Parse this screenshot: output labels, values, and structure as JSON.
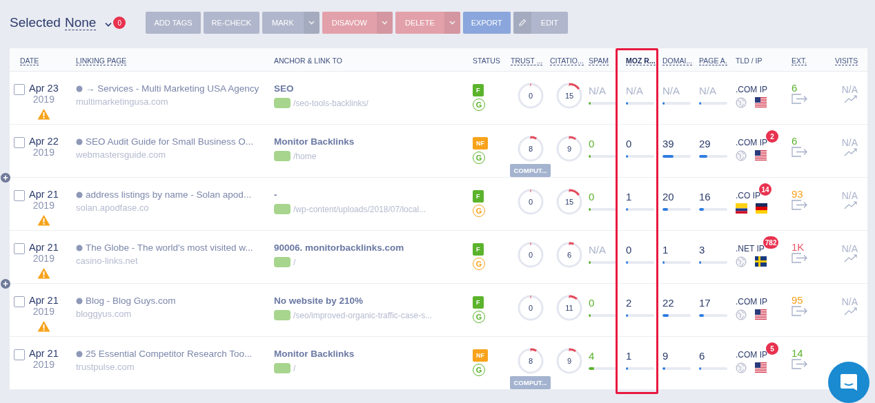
{
  "toolbar": {
    "label": "Selected",
    "selection": "None",
    "count": "0",
    "buttons": [
      {
        "label": "ADD TAGS",
        "kind": "plain",
        "color": "#b0b6cb"
      },
      {
        "label": "RE-CHECK",
        "kind": "plain",
        "color": "#b0b6cb"
      },
      {
        "label": "MARK",
        "kind": "split",
        "color": "#b0b6cb"
      },
      {
        "label": "DISAVOW",
        "kind": "split",
        "color": "#e2a0aa"
      },
      {
        "label": "DELETE",
        "kind": "split",
        "color": "#e2a0aa"
      },
      {
        "label": "EXPORT",
        "kind": "plain",
        "color": "#8aa6dc"
      },
      {
        "label": "EDIT",
        "kind": "pencil",
        "color": "#b0b6cb"
      }
    ]
  },
  "table": {
    "columns": [
      {
        "label": "DATE",
        "sortable": true,
        "highlighted": false
      },
      {
        "label": "LINKING PAGE",
        "sortable": true,
        "highlighted": false
      },
      {
        "label": "ANCHOR & LINK TO",
        "sortable": false,
        "highlighted": false
      },
      {
        "label": "STATUS",
        "sortable": false,
        "highlighted": false
      },
      {
        "label": "TRUST ...",
        "sortable": true,
        "highlighted": false
      },
      {
        "label": "CITATIO...",
        "sortable": true,
        "highlighted": false
      },
      {
        "label": "SPAM",
        "sortable": true,
        "highlighted": false
      },
      {
        "label": "MOZ R...",
        "sortable": true,
        "highlighted": true
      },
      {
        "label": "DOMAI...",
        "sortable": true,
        "highlighted": false
      },
      {
        "label": "PAGE A.",
        "sortable": true,
        "highlighted": false
      },
      {
        "label": "TLD / IP",
        "sortable": false,
        "highlighted": false
      },
      {
        "label": "EXT.",
        "sortable": true,
        "highlighted": false
      },
      {
        "label": "VISITS",
        "sortable": true,
        "highlighted": false
      }
    ],
    "rows": [
      {
        "checked": false,
        "add_above": false,
        "date": "Apr 23",
        "year": "2019",
        "warning": true,
        "title": "→ Services - Multi Marketing USA Agency",
        "domain": "multimarketingusa.com",
        "anchor": "SEO",
        "link": "/seo-tools-backlinks/",
        "follow": "F",
        "google": "G",
        "google_ok": true,
        "trust": {
          "value": "0",
          "level": 0
        },
        "citation": {
          "value": "15",
          "level": 0.15
        },
        "spam": {
          "value": "N/A",
          "level": 0,
          "color": "#aab3cb"
        },
        "moz": {
          "value": "N/A",
          "level": 0,
          "color": "#aab3cb"
        },
        "domain_auth": {
          "value": "N/A",
          "level": 0,
          "color": "#aab3cb"
        },
        "page_auth": {
          "value": "N/A",
          "level": 0,
          "color": "#aab3cb"
        },
        "tld_ip": ".COM IP",
        "flags": [
          {
            "kind": "globe"
          },
          {
            "kind": "us"
          }
        ],
        "ext": {
          "value": "6",
          "color": "#5bb32c"
        },
        "visits": "N/A"
      },
      {
        "checked": false,
        "add_above": false,
        "date": "Apr 22",
        "year": "2019",
        "warning": false,
        "title": "SEO Audit Guide for Small Business O...",
        "domain": "webmastersguide.com",
        "anchor": "Monitor Backlinks",
        "link": "/home",
        "follow": "NF",
        "google": "G",
        "google_ok": true,
        "trust": {
          "value": "8",
          "level": 0.08
        },
        "citation": {
          "value": "9",
          "level": 0.09
        },
        "computing": "COMPUT...",
        "spam": {
          "value": "0",
          "level": 0,
          "color": "#5bb32c"
        },
        "moz": {
          "value": "0",
          "level": 0,
          "color": "#2a3a6b"
        },
        "domain_auth": {
          "value": "39",
          "level": 0.39,
          "color": "#2a3a6b"
        },
        "page_auth": {
          "value": "29",
          "level": 0.29,
          "color": "#2a3a6b"
        },
        "tld_ip": ".COM IP",
        "ip_count": "2",
        "flags": [
          {
            "kind": "globe"
          },
          {
            "kind": "us"
          }
        ],
        "ext": {
          "value": "6",
          "color": "#5bb32c"
        },
        "visits": "N/A"
      },
      {
        "checked": false,
        "add_above": true,
        "date": "Apr 21",
        "year": "2019",
        "warning": true,
        "title": "address listings by name - Solan apod...",
        "domain": "solan.apodfase.co",
        "anchor": "-",
        "link": "/wp-content/uploads/2018/07/local...",
        "follow": "F",
        "google": "G",
        "google_ok": false,
        "trust": {
          "value": "0",
          "level": 0
        },
        "citation": {
          "value": "15",
          "level": 0.15
        },
        "spam": {
          "value": "0",
          "level": 0,
          "color": "#5bb32c"
        },
        "moz": {
          "value": "1",
          "level": 0.01,
          "color": "#2a3a6b"
        },
        "domain_auth": {
          "value": "20",
          "level": 0.2,
          "color": "#2a3a6b"
        },
        "page_auth": {
          "value": "16",
          "level": 0.16,
          "color": "#2a3a6b"
        },
        "tld_ip": ".CO IP",
        "ip_count": "14",
        "flags": [
          {
            "kind": "co"
          },
          {
            "kind": "de"
          }
        ],
        "ext": {
          "value": "93",
          "color": "#f5a11c"
        },
        "visits": "N/A"
      },
      {
        "checked": false,
        "add_above": false,
        "date": "Apr 21",
        "year": "2019",
        "warning": true,
        "title": "The Globe - The world's most visited w...",
        "domain": "casino-links.net",
        "anchor": "90006. monitorbacklinks.com",
        "link": "/",
        "follow": "F",
        "google": "G",
        "google_ok": false,
        "trust": {
          "value": "0",
          "level": 0
        },
        "citation": {
          "value": "6",
          "level": 0.06
        },
        "spam": {
          "value": "N/A",
          "level": 0,
          "color": "#aab3cb"
        },
        "moz": {
          "value": "0",
          "level": 0,
          "color": "#2a3a6b"
        },
        "domain_auth": {
          "value": "1",
          "level": 0.01,
          "color": "#2a3a6b"
        },
        "page_auth": {
          "value": "3",
          "level": 0.03,
          "color": "#2a3a6b"
        },
        "tld_ip": ".NET IP",
        "ip_count": "782",
        "flags": [
          {
            "kind": "globe"
          },
          {
            "kind": "se"
          }
        ],
        "ext": {
          "value": "1K",
          "color": "#e8566a"
        },
        "visits": "N/A"
      },
      {
        "checked": false,
        "add_above": true,
        "date": "Apr 21",
        "year": "2019",
        "warning": true,
        "title": "Blog - Blog Guys.com",
        "domain": "bloggyus.com",
        "anchor": "No website by 210%",
        "link": "/seo/improved-organic-traffic-case-s...",
        "follow": "F",
        "google": "G",
        "google_ok": true,
        "trust": {
          "value": "0",
          "level": 0
        },
        "citation": {
          "value": "11",
          "level": 0.11
        },
        "spam": {
          "value": "0",
          "level": 0,
          "color": "#5bb32c"
        },
        "moz": {
          "value": "2",
          "level": 0.02,
          "color": "#2a3a6b"
        },
        "domain_auth": {
          "value": "22",
          "level": 0.22,
          "color": "#2a3a6b"
        },
        "page_auth": {
          "value": "17",
          "level": 0.17,
          "color": "#2a3a6b"
        },
        "tld_ip": ".COM IP",
        "flags": [
          {
            "kind": "globe"
          },
          {
            "kind": "us"
          }
        ],
        "ext": {
          "value": "95",
          "color": "#f5a11c"
        },
        "visits": "N/A"
      },
      {
        "checked": false,
        "add_above": false,
        "date": "Apr 21",
        "year": "2019",
        "warning": false,
        "title": "25 Essential Competitor Research Too...",
        "domain": "trustpulse.com",
        "anchor": "Monitor Backlinks",
        "link": "/",
        "follow": "NF",
        "google": "G",
        "google_ok": true,
        "trust": {
          "value": "8",
          "level": 0.08
        },
        "citation": {
          "value": "9",
          "level": 0.09
        },
        "computing": "COMPUT...",
        "spam": {
          "value": "4",
          "level": 0.2,
          "color": "#5bb32c"
        },
        "moz": {
          "value": "1",
          "level": 0.01,
          "color": "#2a3a6b"
        },
        "domain_auth": {
          "value": "9",
          "level": 0.09,
          "color": "#2a3a6b"
        },
        "page_auth": {
          "value": "6",
          "level": 0.06,
          "color": "#2a3a6b"
        },
        "tld_ip": ".COM IP",
        "ip_count": "5",
        "flags": [
          {
            "kind": "globe"
          },
          {
            "kind": "us"
          }
        ],
        "ext": {
          "value": "14",
          "color": "#5bb32c"
        }
      }
    ]
  }
}
